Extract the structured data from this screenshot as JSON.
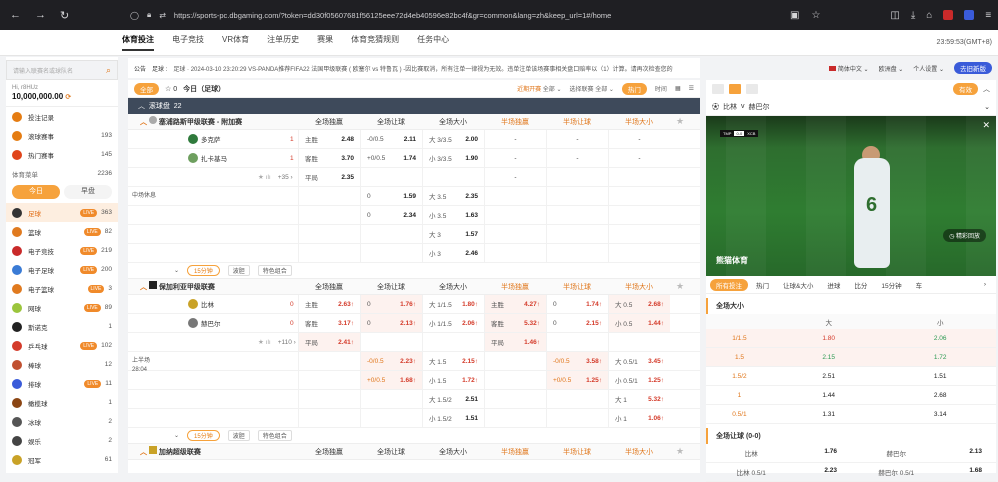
{
  "browser": {
    "url": "https://sports-pc.dbgaming.com/?token=dd30f05607681f56125eee72d4eb40596e82bc4f&gr=common&lang=zh&keep_url=1#/home"
  },
  "topnav": {
    "items": [
      "体育投注",
      "电子竞技",
      "VR体育",
      "注单历史",
      "赛果",
      "体育竞猜规则",
      "任务中心"
    ],
    "active": "体育投注",
    "time": "23:59:53(GMT+8)"
  },
  "notice": {
    "label": "公告",
    "label2": "足球 :",
    "text": "足球 · 2024-03-10 23:20:29 VS-PANDA推荐FIFA22 法国甲级联赛 ( 欧塞尔 vs 特鲁瓦 ) -因比赛取消，所有注单一律视为无效。违单注单该场赛事相关盘口赔率以（1）计算。请再次检查您的"
  },
  "rightbar": {
    "lang": "简体中文",
    "odds": "欧洲盘",
    "settings": "个人设置",
    "newbtn": "去旧新版"
  },
  "left": {
    "search_placeholder": "请输入联赛名或球队名",
    "user": "Hi, r8HUz",
    "balance": "10,000,000.00",
    "items": [
      {
        "label": "投注记录",
        "count": "",
        "color": "#e57c12"
      },
      {
        "label": "滚球赛事",
        "count": "193",
        "color": "#e57c12"
      },
      {
        "label": "热门赛事",
        "count": "145",
        "color": "#e0441a"
      }
    ],
    "menu_title": "体育菜单",
    "menu_count": "2236",
    "tab_today": "今日",
    "tab_early": "早盘",
    "sports": [
      {
        "label": "足球",
        "live": true,
        "count": "363",
        "sel": true,
        "color": "#333"
      },
      {
        "label": "篮球",
        "live": true,
        "count": "82",
        "color": "#e07a1f"
      },
      {
        "label": "电子竞技",
        "live": true,
        "count": "219",
        "color": "#c92a2a"
      },
      {
        "label": "电子足球",
        "live": true,
        "count": "200",
        "color": "#3a7bd5"
      },
      {
        "label": "电子篮球",
        "live": true,
        "count": "3",
        "color": "#e07a1f"
      },
      {
        "label": "网球",
        "live": true,
        "count": "89",
        "color": "#9bc53d"
      },
      {
        "label": "斯诺克",
        "live": false,
        "count": "1",
        "color": "#222"
      },
      {
        "label": "乒乓球",
        "live": true,
        "count": "102",
        "color": "#d43b2a"
      },
      {
        "label": "棒球",
        "live": false,
        "count": "12",
        "color": "#c05030"
      },
      {
        "label": "排球",
        "live": true,
        "count": "11",
        "color": "#3a5bd9"
      },
      {
        "label": "橄榄球",
        "live": false,
        "count": "1",
        "color": "#8b4513"
      },
      {
        "label": "冰球",
        "live": false,
        "count": "2",
        "color": "#555"
      },
      {
        "label": "娱乐",
        "live": false,
        "count": "2",
        "color": "#444"
      },
      {
        "label": "冠军",
        "live": false,
        "count": "61",
        "color": "#c9a227"
      }
    ]
  },
  "main": {
    "all": "全部",
    "star_count": "0",
    "title": "今日（足球）",
    "sort": "近期开赛",
    "sort_val": "全部",
    "select": "选择联赛",
    "select_val": "全部",
    "hot": "热门",
    "time": "时间",
    "roll_label": "滚球盘",
    "roll_count": "22",
    "cols": [
      "全场独赢",
      "全场让球",
      "全场大小",
      "半场独赢",
      "半场让球",
      "半场大小"
    ],
    "league1": {
      "name": "塞浦路斯甲级联赛 - 附加赛",
      "status": "中场休息",
      "team1": "多克萨",
      "team2": "扎卡基马",
      "score1": "1",
      "score2": "1",
      "more": "+35",
      "rows": [
        [
          "主胜",
          "2.48",
          "-0/0.5",
          "2.11",
          "大",
          "3/3.5",
          "2.00",
          "-",
          "-",
          "-"
        ],
        [
          "客胜",
          "3.70",
          "+0/0.5",
          "1.74",
          "小",
          "3/3.5",
          "1.90",
          "-",
          "-",
          "-"
        ],
        [
          "平局",
          "2.35",
          "",
          "",
          "",
          "",
          "",
          "-",
          "",
          ""
        ],
        [
          "",
          "",
          "0",
          "1.59",
          "大",
          "3.5",
          "2.35",
          "",
          "",
          ""
        ],
        [
          "",
          "",
          "0",
          "2.34",
          "小",
          "3.5",
          "1.63",
          "",
          "",
          ""
        ],
        [
          "",
          "",
          "",
          "",
          "大",
          "3",
          "1.57",
          "",
          "",
          ""
        ],
        [
          "",
          "",
          "",
          "",
          "小",
          "3",
          "2.46",
          "",
          "",
          ""
        ]
      ],
      "btn1": "15分钟",
      "btn2": "波胆",
      "btn3": "特色组合"
    },
    "league2": {
      "name": "保加利亚甲级联赛",
      "status": "上半场",
      "status2": "28:04",
      "team1": "比林",
      "team2": "赫巴尔",
      "score1": "0",
      "score2": "0",
      "more": "+110",
      "btn1": "15分钟",
      "btn2": "波胆",
      "btn3": "特色组合"
    },
    "league3": {
      "name": "加纳超级联赛"
    }
  },
  "right": {
    "tab_active": "有效",
    "match_team1": "比林",
    "vs": "v",
    "match_team2": "赫巴尔",
    "video_score_home": "TMP",
    "video_score_away": "XCB",
    "video_logo": "熊猫体育",
    "replay": "精彩回放",
    "tabs": [
      "所有投注",
      "热门",
      "让球&大小",
      "进球",
      "比分",
      "15分钟",
      "车"
    ],
    "market1": "全场大小",
    "col_big": "大",
    "col_small": "小",
    "odds": [
      {
        "line": "1/1.5",
        "big": "1.80",
        "small": "2.06",
        "big_c": "up",
        "small_c": "dn",
        "hi": true
      },
      {
        "line": "1.5",
        "big": "2.15",
        "small": "1.72",
        "big_c": "dn",
        "small_c": "dn",
        "hi": true
      },
      {
        "line": "1.5/2",
        "big": "2.51",
        "small": "1.51"
      },
      {
        "line": "1",
        "big": "1.44",
        "small": "2.68"
      },
      {
        "line": "0.5/1",
        "big": "1.31",
        "small": "3.14"
      }
    ],
    "market2": "全场让球 (0-0)",
    "ah": {
      "t1": "比林",
      "v1": "1.76",
      "t2": "赫巴尔",
      "v2": "2.13",
      "r2k1": "比林 0.5/1",
      "r2v1": "2.23",
      "r2k2": "赫巴尔 0.5/1",
      "r2v2": "1.68"
    }
  }
}
